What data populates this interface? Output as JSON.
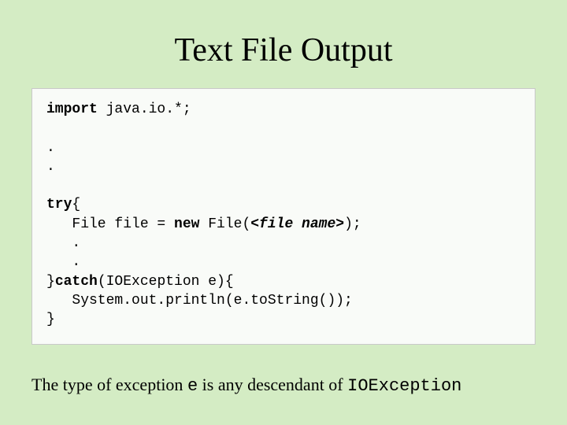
{
  "title": "Text File Output",
  "code": {
    "l1a": "import",
    "l1b": " java.io.*;",
    "l2": ".",
    "l3": ".",
    "l4a": "try",
    "l4b": "{",
    "l5a": "   File file = ",
    "l5b": "new",
    "l5c": " File(",
    "l5d": "<file name>",
    "l5e": ");",
    "l6": "   .",
    "l7": "   .",
    "l8a": "}",
    "l8b": "catch",
    "l8c": "(IOException e){",
    "l9": "   System.out.println(e.toString());",
    "l10": "}"
  },
  "caption": {
    "p1": "The type of exception ",
    "p2": "e",
    "p3": " is any descendant of ",
    "p4": "IOException"
  }
}
